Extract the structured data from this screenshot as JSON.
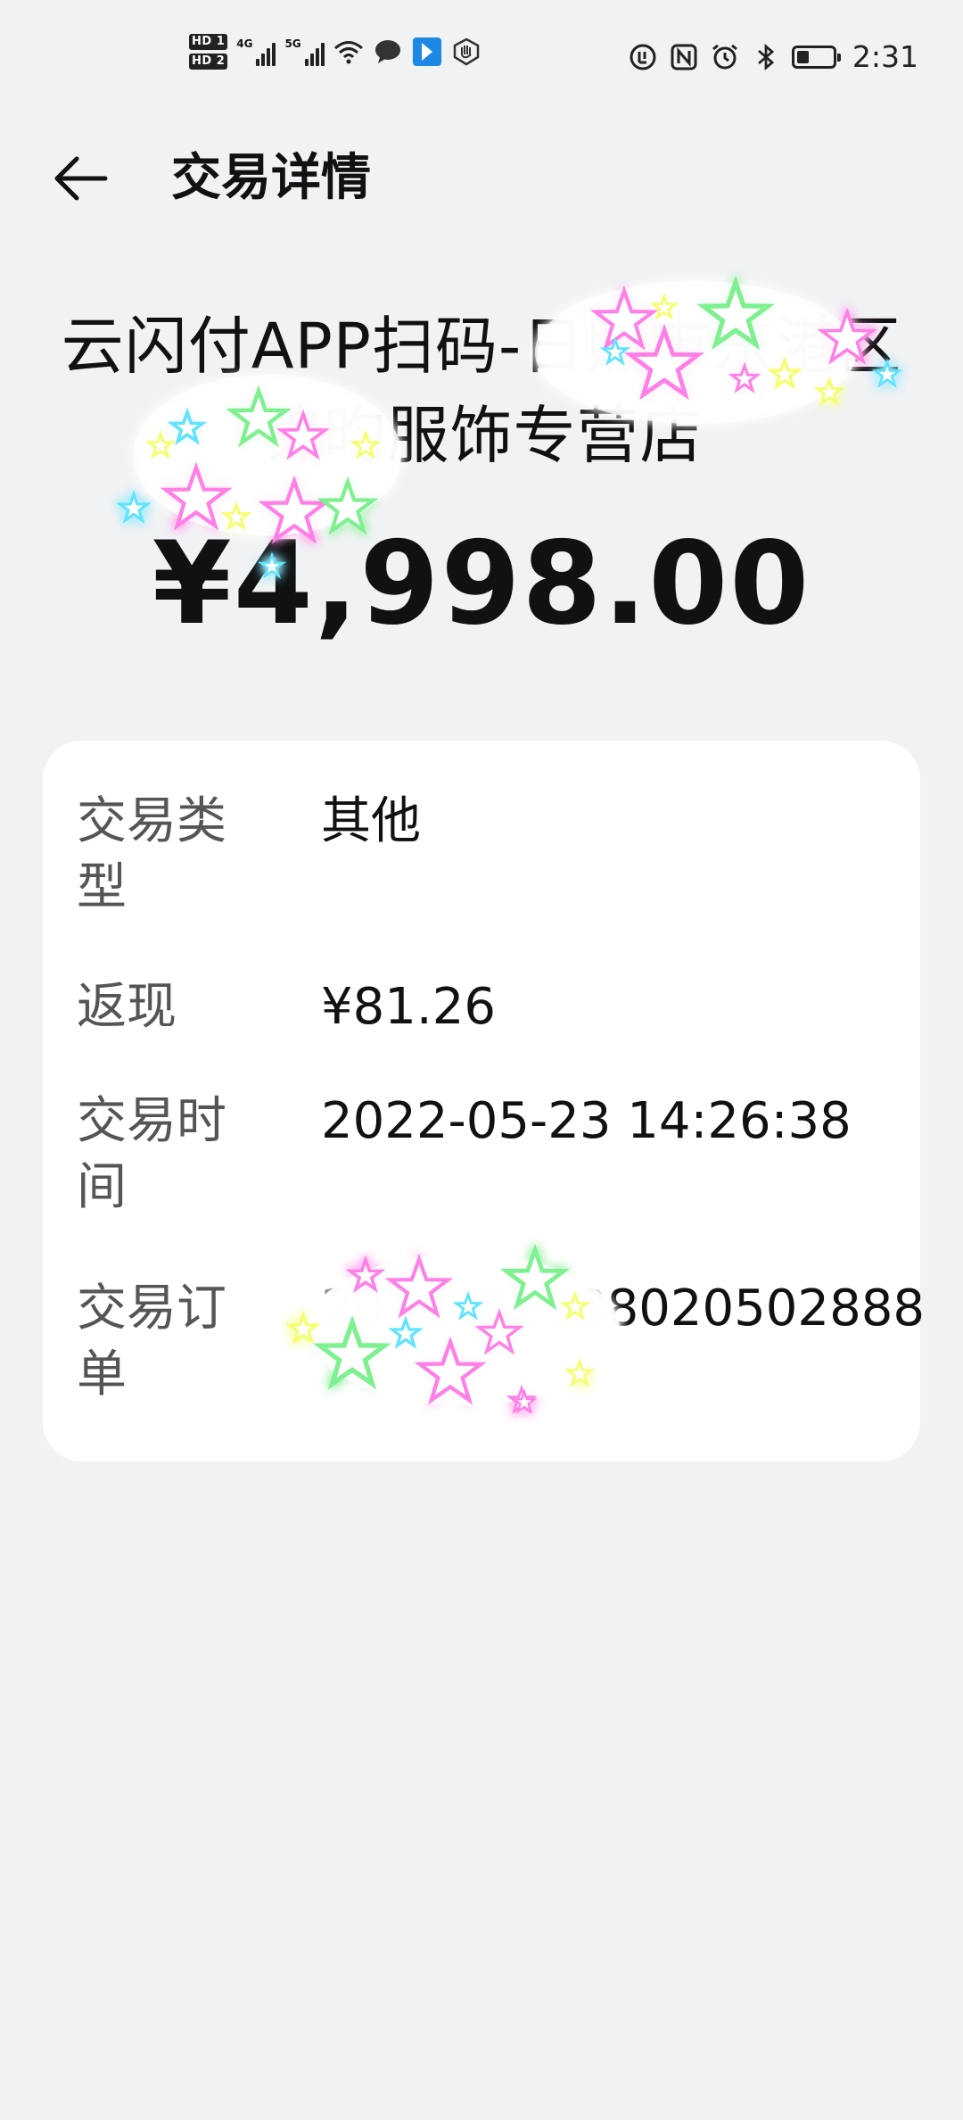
{
  "status_bar": {
    "hd1": "HD 1",
    "hd2": "HD 2",
    "net1": "4G",
    "net2": "5G",
    "time": "2:31",
    "battery_level": 0.35
  },
  "header": {
    "back_icon": "arrow-left-icon",
    "title": "交易详情"
  },
  "summary": {
    "merchant": "云闪付APP扫码-日照市东港区锦昀服饰专营店",
    "amount": "¥4,998.00"
  },
  "details": [
    {
      "label": "交易类型",
      "value": "其他"
    },
    {
      "label": "返现",
      "value": "¥81.26"
    },
    {
      "label": "交易时间",
      "value": "2022-05-23 14:26:38"
    },
    {
      "label": "交易订单",
      "value": "2022052338020502888"
    }
  ],
  "colors": {
    "background": "#f1f2f4",
    "card": "#ffffff",
    "text_primary": "#111111",
    "text_secondary": "#555555",
    "star_pink": "#ff7fe6",
    "star_green": "#7ef08f",
    "star_cyan": "#5ee3ff",
    "star_yellow": "#f4ff6a"
  }
}
